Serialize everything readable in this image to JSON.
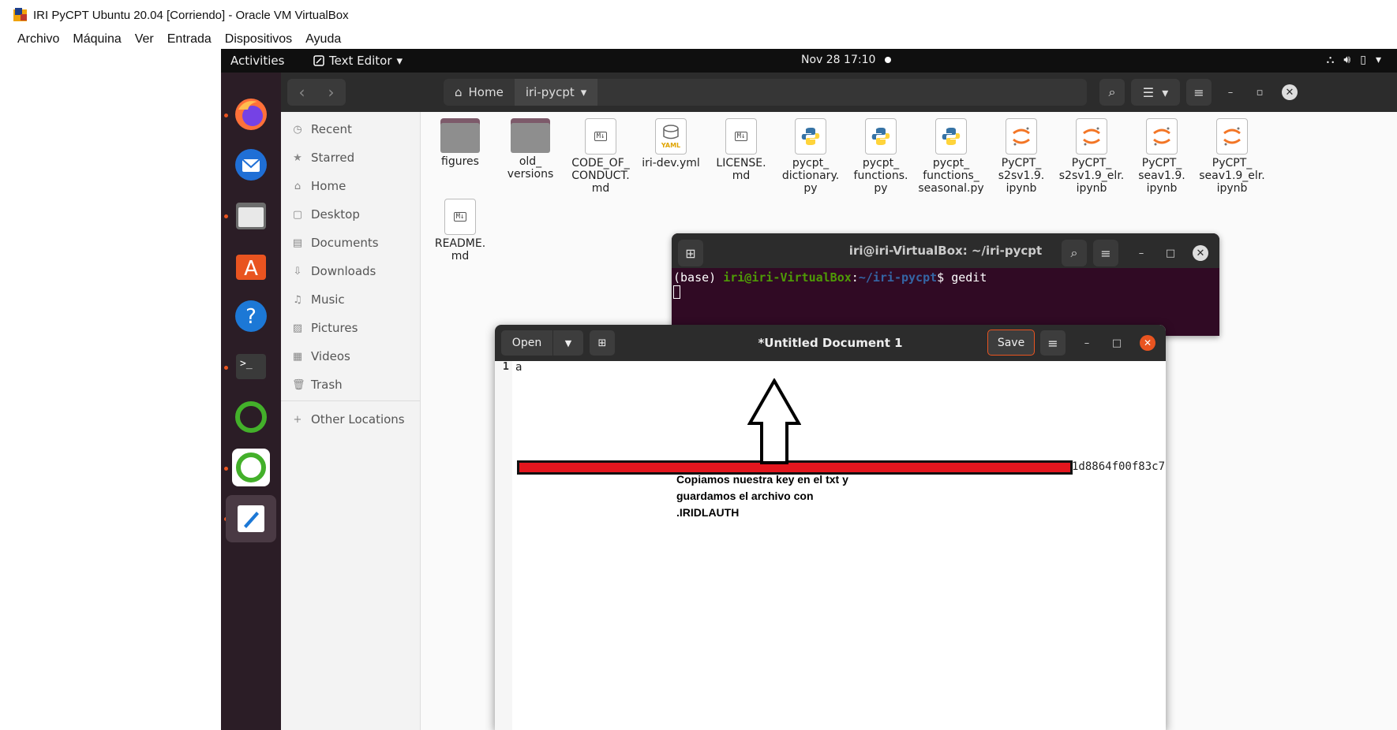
{
  "host": {
    "title": "IRI PyCPT Ubuntu 20.04 [Corriendo] - Oracle VM VirtualBox",
    "menu": [
      "Archivo",
      "Máquina",
      "Ver",
      "Entrada",
      "Dispositivos",
      "Ayuda"
    ]
  },
  "topbar": {
    "activities": "Activities",
    "app_menu": "Text Editor",
    "clock": "Nov 28  17:10"
  },
  "dock": [
    "firefox-icon",
    "thunderbird-icon",
    "files-icon",
    "software-icon",
    "help-icon",
    "terminal-icon",
    "anaconda-icon",
    "anaconda-navigator-icon",
    "text-editor-icon"
  ],
  "files": {
    "path": [
      "Home",
      "iri-pycpt"
    ],
    "sidebar": [
      "Recent",
      "Starred",
      "Home",
      "Desktop",
      "Documents",
      "Downloads",
      "Music",
      "Pictures",
      "Videos",
      "Trash"
    ],
    "other_locations": "Other Locations",
    "items": [
      {
        "name": "figures",
        "type": "folder"
      },
      {
        "name": "old_\nversions",
        "type": "folder"
      },
      {
        "name": "CODE_OF_\nCONDUCT.\nmd",
        "type": "md"
      },
      {
        "name": "iri-dev.yml",
        "type": "yml"
      },
      {
        "name": "LICENSE.\nmd",
        "type": "md"
      },
      {
        "name": "pycpt_\ndictionary.\npy",
        "type": "py"
      },
      {
        "name": "pycpt_\nfunctions.\npy",
        "type": "py"
      },
      {
        "name": "pycpt_\nfunctions_\nseasonal.py",
        "type": "py"
      },
      {
        "name": "PyCPT_\ns2sv1.9.\nipynb",
        "type": "ipynb"
      },
      {
        "name": "PyCPT_\ns2sv1.9_elr.\nipynb",
        "type": "ipynb"
      },
      {
        "name": "PyCPT_\nseav1.9.\nipynb",
        "type": "ipynb"
      },
      {
        "name": "PyCPT_\nseav1.9_elr.\nipynb",
        "type": "ipynb"
      },
      {
        "name": "README.\nmd",
        "type": "md"
      }
    ]
  },
  "terminal": {
    "title": "iri@iri-VirtualBox: ~/iri-pycpt",
    "prompt_env": "(base) ",
    "prompt_user": "iri@iri-VirtualBox",
    "prompt_path": "~/iri-pycpt",
    "command": "$ gedit"
  },
  "gedit": {
    "title": "*Untitled Document 1",
    "open_label": "Open",
    "save_label": "Save",
    "line_number": "1",
    "line_start": "a",
    "line_end": "1d8864f00f83c7"
  },
  "annotation": {
    "lines": [
      "Copiamos nuestra key en el txt y",
      "guardamos el archivo con",
      ".IRIDLAUTH"
    ]
  },
  "colors": {
    "ubuntu_orange": "#e95420",
    "redaction": "#e3161e"
  }
}
